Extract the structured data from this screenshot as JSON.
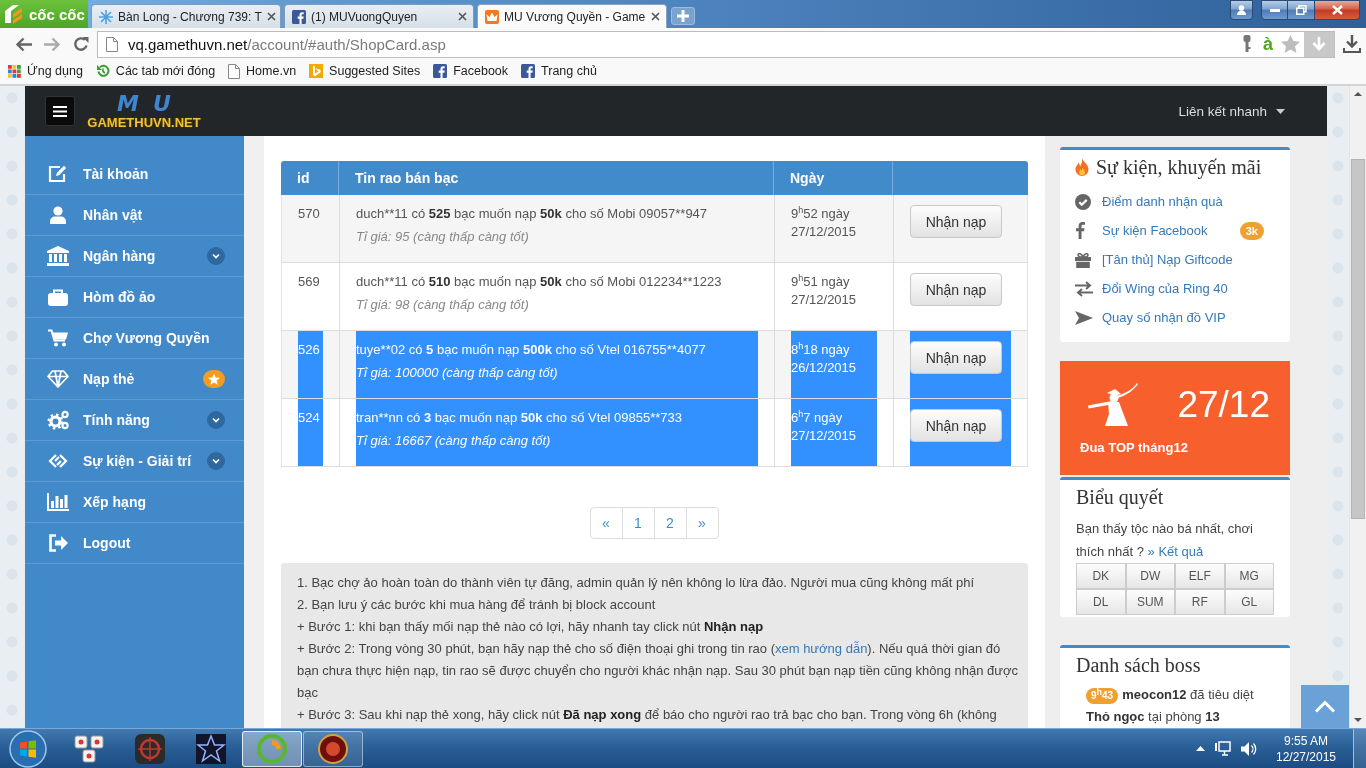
{
  "browser": {
    "brand": "cốc cốc",
    "tabs": [
      {
        "title": "Bàn Long - Chương 739: T",
        "selected": false
      },
      {
        "title": "(1) MUVuongQuyen",
        "selected": false
      },
      {
        "title": "MU Vương Quyền - Game",
        "selected": true
      }
    ],
    "url_host": "vq.gamethuvn.net",
    "url_path": "/account/#auth/ShopCard.asp",
    "typing_mark": "à",
    "bookmarks": [
      {
        "label": "Ứng dụng"
      },
      {
        "label": "Các tab mới đóng"
      },
      {
        "label": "Home.vn"
      },
      {
        "label": "Suggested Sites"
      },
      {
        "label": "Facebook"
      },
      {
        "label": "Trang chủ"
      }
    ]
  },
  "navbar": {
    "logo_mark": "MU",
    "logo_text": "GAMETHUVN.NET",
    "quick_links": "Liên kết nhanh"
  },
  "sidebar": {
    "items": [
      {
        "label": "Tài khoản",
        "expandable": false,
        "starred": false
      },
      {
        "label": "Nhân vật",
        "expandable": false,
        "starred": false
      },
      {
        "label": "Ngân hàng",
        "expandable": true,
        "starred": false
      },
      {
        "label": "Hòm đồ ảo",
        "expandable": false,
        "starred": false
      },
      {
        "label": "Chợ Vương Quyền",
        "expandable": false,
        "starred": false
      },
      {
        "label": "Nạp thẻ",
        "expandable": false,
        "starred": true
      },
      {
        "label": "Tính năng",
        "expandable": true,
        "starred": false
      },
      {
        "label": "Sự kiện - Giải trí",
        "expandable": true,
        "starred": false
      },
      {
        "label": "Xếp hạng",
        "expandable": false,
        "starred": false
      },
      {
        "label": "Logout",
        "expandable": false,
        "starred": false
      }
    ]
  },
  "table": {
    "columns": [
      "id",
      "Tin rao bán bạc",
      "Ngày"
    ],
    "rows": [
      {
        "id": "570",
        "message": [
          {
            "kind": "text",
            "text": "duch**11 có "
          },
          {
            "kind": "bold",
            "text": "525"
          },
          {
            "kind": "text",
            "text": " bạc muốn nạp "
          },
          {
            "kind": "bold",
            "text": "50k"
          },
          {
            "kind": "text",
            "text": " cho số Mobi 09057**947"
          }
        ],
        "rate": "Tỉ giá: 95 (càng thấp càng tốt)",
        "date": "9$^{h}$52 ngày 27/12/2015",
        "button": "Nhận nạp",
        "selected": false
      },
      {
        "id": "569",
        "message": [
          {
            "kind": "text",
            "text": "duch**11 có "
          },
          {
            "kind": "bold",
            "text": "510"
          },
          {
            "kind": "text",
            "text": " bạc muốn nạp "
          },
          {
            "kind": "bold",
            "text": "50k"
          },
          {
            "kind": "text",
            "text": " cho số Mobi 012234**1223"
          }
        ],
        "rate": "Tỉ giá: 98 (càng thấp càng tốt)",
        "date": "9$^{h}$51 ngày 27/12/2015",
        "button": "Nhận nạp",
        "selected": false
      },
      {
        "id": "526",
        "message": [
          {
            "kind": "text",
            "text": "tuye**02 có "
          },
          {
            "kind": "bold",
            "text": "5"
          },
          {
            "kind": "text",
            "text": " bạc muốn nạp "
          },
          {
            "kind": "bold",
            "text": "500k"
          },
          {
            "kind": "text",
            "text": " cho số Vtel 016755**4077"
          }
        ],
        "rate": "Tỉ giá: 100000 (càng thấp càng tốt)",
        "date": "8$^{h}$18 ngày 26/12/2015",
        "button": "Nhận nạp",
        "selected": true
      },
      {
        "id": "524",
        "message": [
          {
            "kind": "text",
            "text": "tran**nn có "
          },
          {
            "kind": "bold",
            "text": "3"
          },
          {
            "kind": "text",
            "text": " bạc muốn nạp "
          },
          {
            "kind": "bold",
            "text": "50k"
          },
          {
            "kind": "text",
            "text": " cho số Vtel 09855**733"
          }
        ],
        "rate": "Tỉ giá: 16667 (càng thấp càng tốt)",
        "date": "6$^{h}$7 ngày 27/12/2015",
        "button": "Nhận nạp",
        "selected": true
      }
    ]
  },
  "pagination": [
    {
      "label": "«",
      "selected": false
    },
    {
      "label": "1",
      "selected": false
    },
    {
      "label": "2",
      "selected": false
    },
    {
      "label": "»",
      "selected": false
    }
  ],
  "notes": [
    {
      "segments": [
        {
          "kind": "text",
          "text": "1. Bạc chợ ảo hoàn toàn do thành viên tự đăng, admin quản lý nên không lo lừa đảo. Người mua cũng không mất phí"
        }
      ]
    },
    {
      "segments": [
        {
          "kind": "text",
          "text": "2. Bạn lưu ý các bước khi mua hàng để tránh bị block account"
        }
      ]
    },
    {
      "segments": [
        {
          "kind": "text",
          "text": "+ Bước 1: khi bạn thấy mối nạp thẻ nào có lợi, hãy nhanh tay click nút "
        },
        {
          "kind": "bold",
          "text": "Nhận nạp"
        }
      ]
    },
    {
      "segments": [
        {
          "kind": "text",
          "text": "+ Bước 2: Trong vòng 30 phút, bạn hãy nạp thẻ cho số điện thoại ghi trong tin rao ("
        },
        {
          "kind": "link",
          "text": "xem hướng dẫn"
        },
        {
          "kind": "text",
          "text": "). Nếu quá thời gian đó bạn chưa thực hiện nạp, tin rao sẽ được chuyển cho người khác nhận nạp. Sau 30 phút bạn nạp tiền cũng không nhận được bạc"
        }
      ]
    },
    {
      "segments": [
        {
          "kind": "text",
          "text": "+ Bước 3: Sau khi nạp thẻ xong, hãy click nút "
        },
        {
          "kind": "bold",
          "text": "Đã nạp xong"
        },
        {
          "kind": "text",
          "text": " để báo cho người rao trả bạc cho bạn. Trong vòng 6h (không"
        }
      ]
    }
  ],
  "events": {
    "title": "Sự kiện, khuyến mãi",
    "links": [
      {
        "label": "Điểm danh nhận quà"
      },
      {
        "label": "Sự kiện Facebook",
        "badge": "3k"
      },
      {
        "label": "[Tân thủ] Nạp Giftcode"
      },
      {
        "label": "Đổi Wing của Ring 40"
      },
      {
        "label": "Quay số nhận đồ VIP"
      }
    ]
  },
  "banner": {
    "date": "27/12",
    "caption": "Đua TOP tháng12"
  },
  "poll": {
    "title": "Biểu quyết",
    "question": "Bạn thấy tộc nào bá nhất, chơi thích nhất ?",
    "result_link": "» Kết quả",
    "options": [
      "DK",
      "DW",
      "ELF",
      "MG",
      "DL",
      "SUM",
      "RF",
      "GL"
    ]
  },
  "boss": {
    "title": "Danh sách boss",
    "entries": [
      {
        "time": "9$^{h}$43",
        "segments": [
          {
            "kind": "bold",
            "text": "meocon12"
          },
          {
            "kind": "text",
            "text": " đã tiêu diệt "
          },
          {
            "kind": "bold",
            "text": "Thỏ ngọc"
          },
          {
            "kind": "text",
            "text": " tại phòng "
          },
          {
            "kind": "bold",
            "text": "13"
          }
        ]
      }
    ]
  },
  "taskbar": {
    "apps": [
      {
        "selected": false,
        "running": false
      },
      {
        "selected": false,
        "running": false
      },
      {
        "selected": false,
        "running": false
      },
      {
        "selected": true,
        "running": true
      },
      {
        "selected": false,
        "running": true
      }
    ],
    "time": "9:55 AM",
    "date": "12/27/2015"
  }
}
